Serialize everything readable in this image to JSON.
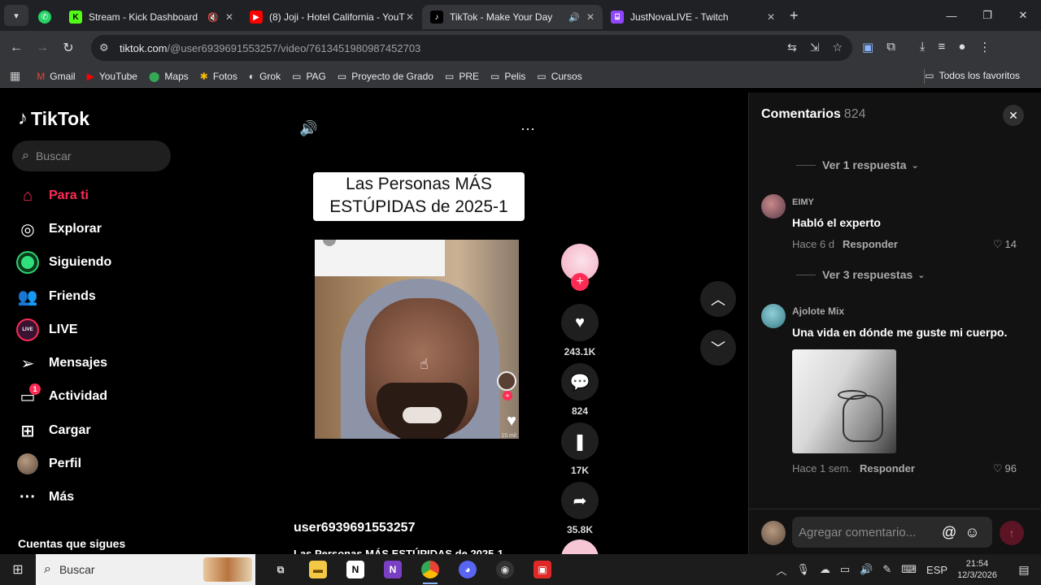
{
  "browser": {
    "tabs": [
      {
        "title": "Stream - Kick Dashboard",
        "icon": "kick-icon",
        "color": "#53fc18",
        "muted": true
      },
      {
        "title": "(8) Joji - Hotel California - YouT",
        "icon": "youtube-icon",
        "color": "#ff0000",
        "muted": false
      },
      {
        "title": "TikTok - Make Your Day",
        "icon": "tiktok-icon",
        "color": "#ffffff",
        "audio": true,
        "active": true
      },
      {
        "title": "JustNovaLIVE - Twitch",
        "icon": "twitch-icon",
        "color": "#9146ff",
        "muted": false
      }
    ],
    "url_host": "tiktok.com",
    "url_path": "/@user6939691553257/video/7613451980987452703",
    "bookmarks": [
      {
        "label": "Gmail",
        "icon": "gmail-icon"
      },
      {
        "label": "YouTube",
        "icon": "youtube-icon"
      },
      {
        "label": "Maps",
        "icon": "maps-icon"
      },
      {
        "label": "Fotos",
        "icon": "photos-icon"
      },
      {
        "label": "Grok",
        "icon": "grok-icon"
      },
      {
        "label": "PAG",
        "icon": "folder-icon"
      },
      {
        "label": "Proyecto de Grado",
        "icon": "folder-icon"
      },
      {
        "label": "PRE",
        "icon": "folder-icon"
      },
      {
        "label": "Pelis",
        "icon": "folder-icon"
      },
      {
        "label": "Cursos",
        "icon": "folder-icon"
      }
    ],
    "all_bookmarks": "Todos los favoritos"
  },
  "sidebar": {
    "logo": "TikTok",
    "search_placeholder": "Buscar",
    "items": [
      {
        "label": "Para ti",
        "icon": "home-icon"
      },
      {
        "label": "Explorar",
        "icon": "compass-icon"
      },
      {
        "label": "Siguiendo",
        "icon": "following-icon"
      },
      {
        "label": "Friends",
        "icon": "friends-icon"
      },
      {
        "label": "LIVE",
        "icon": "live-icon"
      },
      {
        "label": "Mensajes",
        "icon": "send-icon"
      },
      {
        "label": "Actividad",
        "icon": "activity-icon",
        "badge": "1"
      },
      {
        "label": "Cargar",
        "icon": "upload-icon"
      },
      {
        "label": "Perfil",
        "icon": "profile-avatar"
      },
      {
        "label": "Más",
        "icon": "more-icon"
      }
    ],
    "following_title": "Cuentas que sigues",
    "accent": "#fe2c55"
  },
  "video": {
    "title": "Las Personas MÁS ESTÚPIDAS de 2025-1",
    "mini_count": "15 mil",
    "author": "user6939691553257",
    "description": "Las Personas MÁS ESTÚPIDAS de 2025-1",
    "likes": "243.1K",
    "comments": "824",
    "saves": "17K",
    "shares": "35.8K"
  },
  "comments_panel": {
    "title": "Comentarios",
    "count": "824",
    "replies_1": "Ver 1 respuesta",
    "items": [
      {
        "user": "EIMY",
        "text": "Habló el experto",
        "time": "Hace 6 d",
        "reply": "Responder",
        "likes": "14"
      },
      {
        "user": "Ajolote Mix",
        "text": "Una vida en dónde me guste mi cuerpo.",
        "time": "Hace 1 sem.",
        "reply": "Responder",
        "likes": "96"
      }
    ],
    "replies_3": "Ver 3 respuestas",
    "input_placeholder": "Agregar comentario..."
  },
  "taskbar": {
    "search_placeholder": "Buscar",
    "lang": "ESP",
    "time": "21:54",
    "date": "12/3/2026"
  }
}
